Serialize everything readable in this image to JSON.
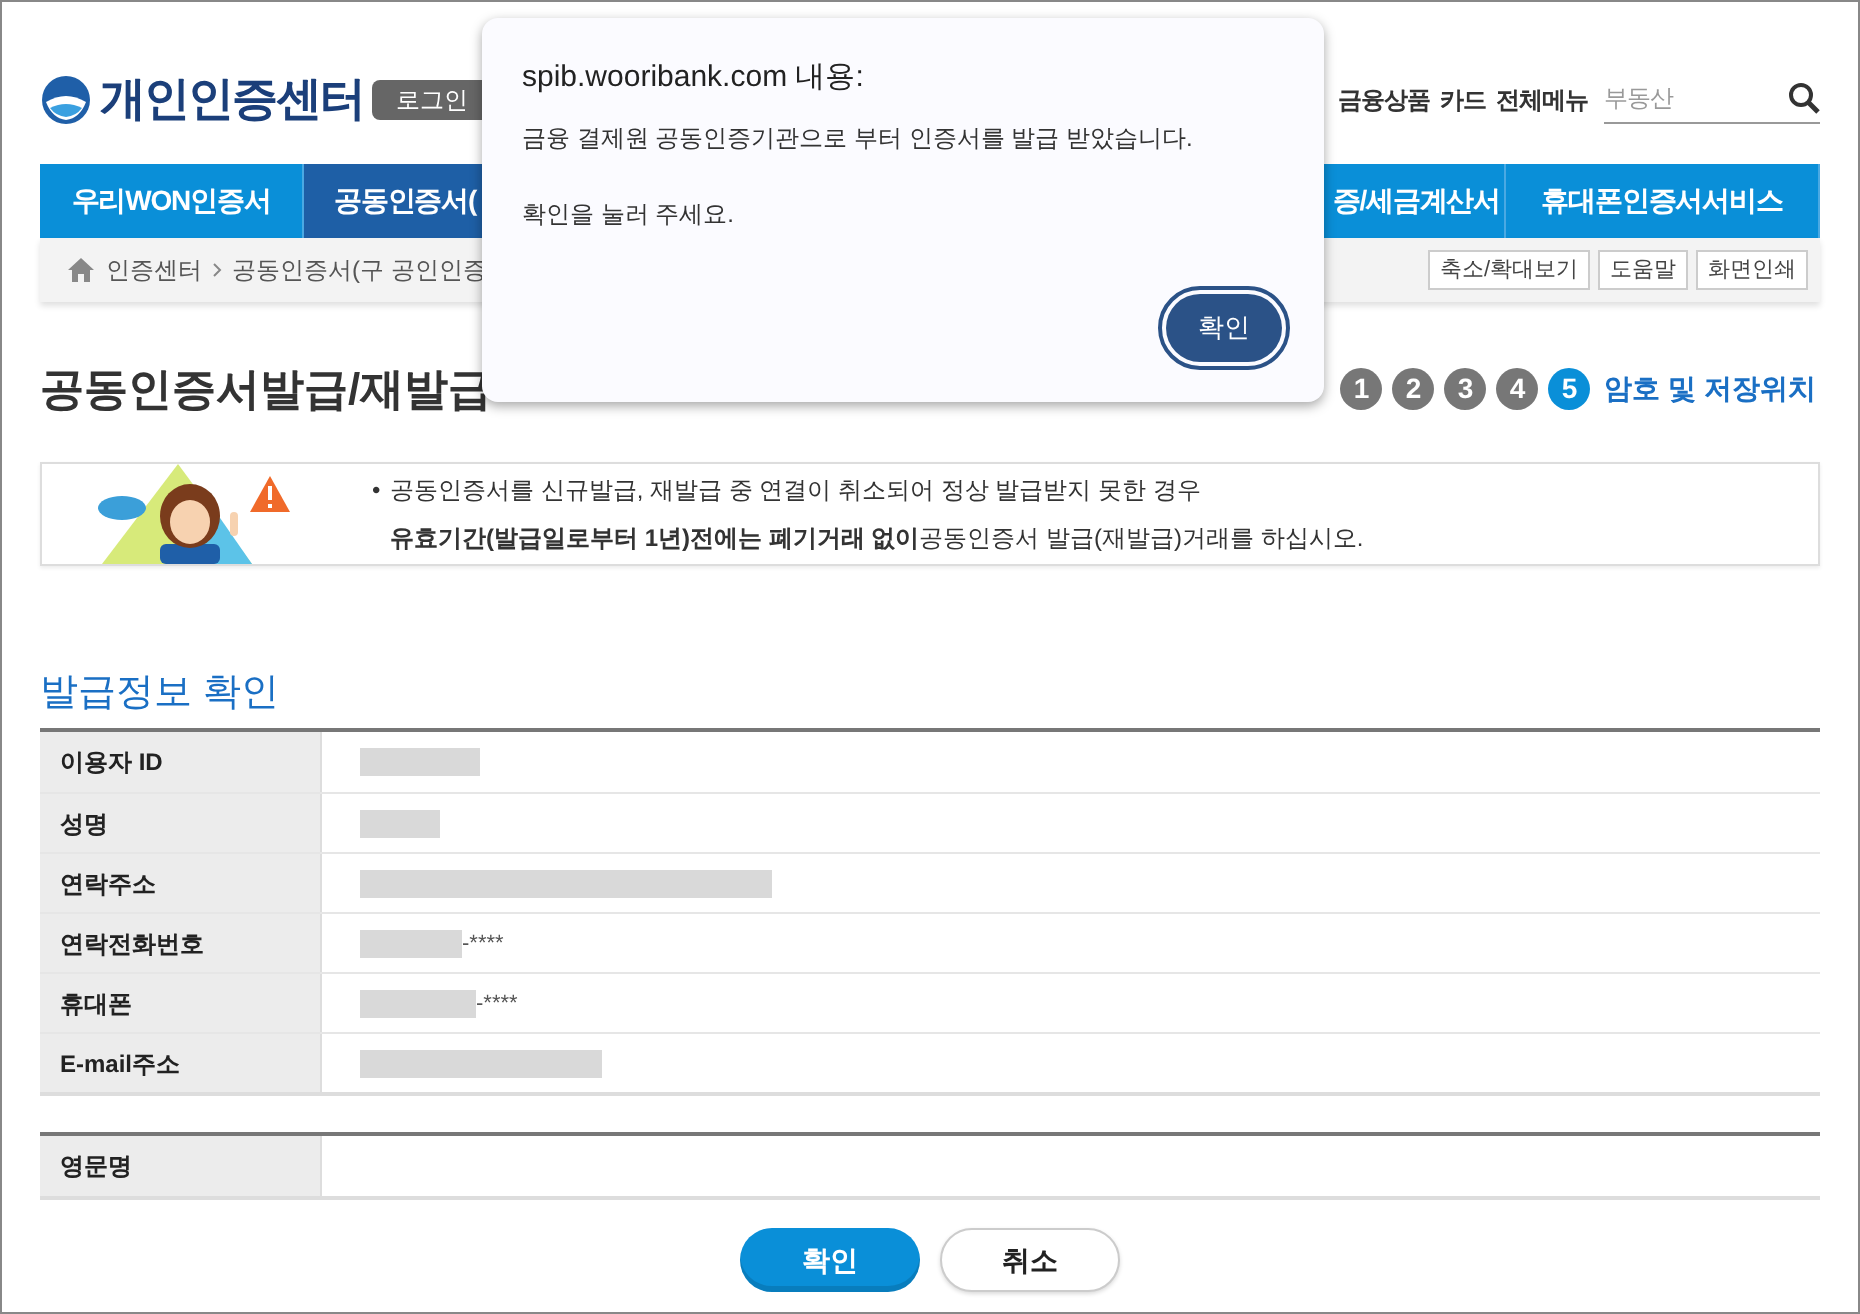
{
  "header": {
    "logo": "개인인증센터",
    "login_button": "로그인",
    "links": [
      "금융상품",
      "카드",
      "전체메뉴"
    ],
    "search": {
      "placeholder": "부동산"
    }
  },
  "nav_tabs": [
    {
      "label": "우리WON인증서",
      "selected": false
    },
    {
      "label": "공동인증서(",
      "selected": true
    },
    {
      "label": "증/세금계산서",
      "selected": false
    },
    {
      "label": "휴대폰인증서서비스",
      "selected": false
    }
  ],
  "breadcrumb": [
    "인증센터",
    "공동인증서(구 공인인증"
  ],
  "tools": [
    "축소/확대보기",
    "도움말",
    "화면인쇄"
  ],
  "page_title": "공동인증서발급/재발급",
  "steps": [
    {
      "label": "1",
      "selected": false
    },
    {
      "label": "2",
      "selected": false
    },
    {
      "label": "3",
      "selected": false
    },
    {
      "label": "4",
      "selected": false
    },
    {
      "label": "5",
      "selected": true
    }
  ],
  "step_title": "암호 및 저장위치",
  "notice": {
    "bullet": "•",
    "lines": [
      "공동인증서를 신규발급, 재발급 중 연결이 취소되어 정상 발급받지 못한 경우",
      "**유효기간(발급일로부터 1년)전에는 폐기거래 없이**공동인증서 발급(재발급)거래를 하십시오."
    ]
  },
  "section_title": "발급정보 확인",
  "info_rows": [
    {
      "label": "이용자 ID",
      "redacted": true
    },
    {
      "label": "성명",
      "redacted": true
    },
    {
      "label": "연락주소",
      "redacted": true
    },
    {
      "label": "연락전화번호",
      "redacted": true,
      "suffix": "-****"
    },
    {
      "label": "휴대폰",
      "redacted": true,
      "suffix": "-****"
    },
    {
      "label": "E-mail주소",
      "redacted": true
    }
  ],
  "extra_rows": [
    {
      "label": "영문명",
      "redacted": false
    }
  ],
  "buttons": [
    {
      "label": "확인",
      "kind": "primary"
    },
    {
      "label": "취소",
      "kind": "secondary"
    }
  ],
  "dialog": {
    "title": "spib.wooribank.com 내용:",
    "message": [
      "금융 결제원 공동인증기관으로 부터 인증서를 발급 받았습니다.",
      "확인을 눌러 주세요."
    ],
    "button": "확인"
  }
}
